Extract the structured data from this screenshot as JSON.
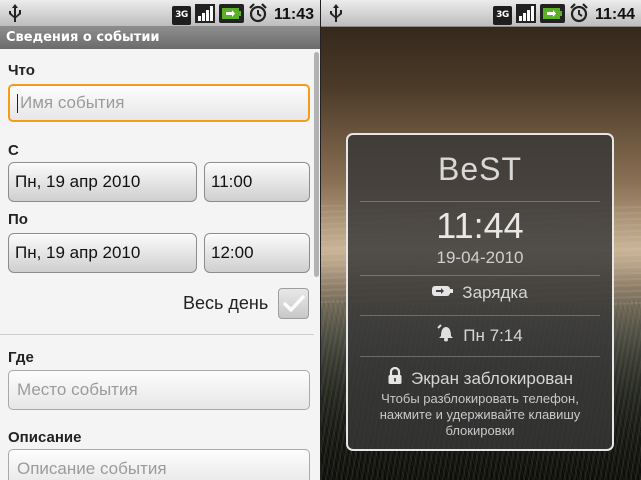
{
  "left_screen": {
    "status_bar": {
      "time": "11:43",
      "network": "3G"
    },
    "title": "Сведения о событии",
    "what": {
      "label": "Что",
      "placeholder": "Имя события"
    },
    "from": {
      "label": "С",
      "date": "Пн, 19 апр 2010",
      "time": "11:00"
    },
    "to": {
      "label": "По",
      "date": "Пн, 19 апр 2010",
      "time": "12:00"
    },
    "all_day": {
      "label": "Весь день",
      "checked": true
    },
    "where": {
      "label": "Где",
      "placeholder": "Место события"
    },
    "description": {
      "label": "Описание",
      "placeholder": "Описание события"
    }
  },
  "right_screen": {
    "status_bar": {
      "time": "11:44",
      "network": "3G"
    },
    "lock": {
      "carrier": "BeST",
      "time": "11:44",
      "date": "19-04-2010",
      "charging": "Зарядка",
      "alarm": "Пн 7:14",
      "locked_title": "Экран заблокирован",
      "hint_line1": "Чтобы разблокировать телефон,",
      "hint_line2": "нажмите и удерживайте клавишу",
      "hint_line3": "блокировки"
    }
  },
  "colors": {
    "focus": "#f39c1a",
    "battery": "#5bb025",
    "titlebar": "#7a7a7a"
  }
}
